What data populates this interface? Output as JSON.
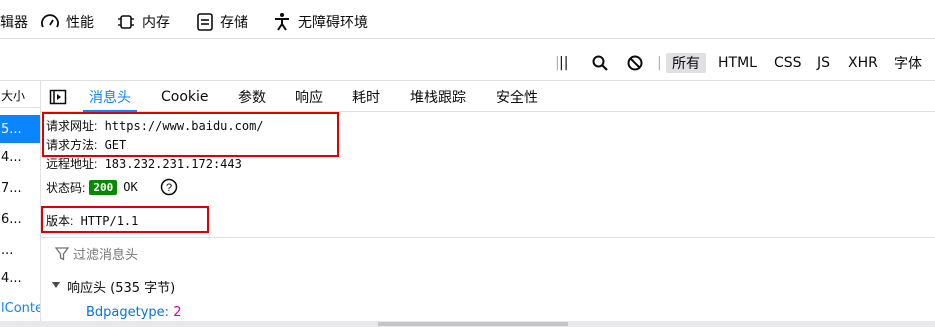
{
  "toptabs": [
    {
      "label": "辑器",
      "icon": "none"
    },
    {
      "label": "性能",
      "icon": "gauge-icon"
    },
    {
      "label": "内存",
      "icon": "chip-icon"
    },
    {
      "label": "存储",
      "icon": "storage-icon"
    },
    {
      "label": "无障碍环境",
      "icon": "accessibility-icon"
    }
  ],
  "filterbar": {
    "pause": "||",
    "types": [
      "所有",
      "HTML",
      "CSS",
      "JS",
      "XHR",
      "字体"
    ],
    "active_type": "所有"
  },
  "reqlist": {
    "header": "大小",
    "rows": [
      "5...",
      "4...",
      "7...",
      "6...",
      "...",
      "4..."
    ],
    "footer": "lConte"
  },
  "detail_tabs": [
    "消息头",
    "Cookie",
    "参数",
    "响应",
    "耗时",
    "堆栈跟踪",
    "安全性"
  ],
  "summary": {
    "url_label": "请求网址:",
    "url": "https://www.baidu.com/",
    "method_label": "请求方法:",
    "method": "GET",
    "remote_label": "远程地址:",
    "remote": "183.232.231.172:443",
    "status_label": "状态码:",
    "status_code": "200",
    "status_text": "OK",
    "version_label": "版本:",
    "version": "HTTP/1.1"
  },
  "filter_headers_placeholder": "过滤消息头",
  "response_headers": {
    "title": "响应头 (535 字节)",
    "first_name": "Bdpagetype:",
    "first_value": "2"
  },
  "colors": {
    "accent": "#0a84ff",
    "highlight": "#e00000",
    "status_ok": "#058b00"
  }
}
